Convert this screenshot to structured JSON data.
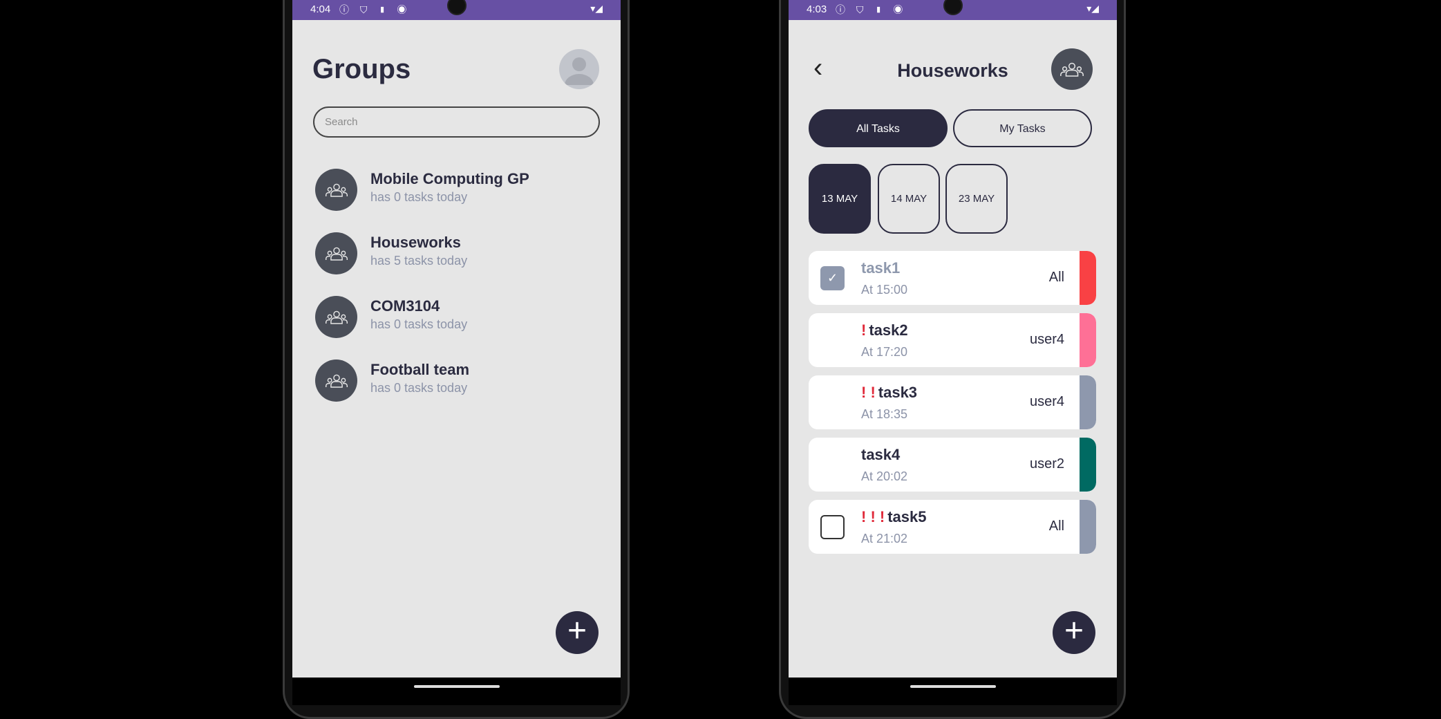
{
  "left_screen": {
    "status": {
      "time": "4:04",
      "icons": "ⓘ ⛉ ▮ ◉",
      "right": "▾◢"
    },
    "title": "Groups",
    "search": {
      "placeholder": "Search"
    },
    "groups": [
      {
        "name": "Mobile Computing GP",
        "subtitle": "has 0 tasks today"
      },
      {
        "name": "Houseworks",
        "subtitle": "has 5 tasks today"
      },
      {
        "name": "COM3104",
        "subtitle": "has 0 tasks today"
      },
      {
        "name": "Football team",
        "subtitle": "has 0 tasks today"
      }
    ],
    "fab": "+"
  },
  "right_screen": {
    "status": {
      "time": "4:03",
      "icons": "ⓘ ⛉ ▮ ◉",
      "right": "▾◢"
    },
    "back": "‹",
    "title": "Houseworks",
    "tabs": [
      {
        "label": "All Tasks",
        "active": true
      },
      {
        "label": "My Tasks",
        "active": false
      }
    ],
    "dates": [
      {
        "label": "13 MAY",
        "active": true
      },
      {
        "label": "14 MAY"
      },
      {
        "label": "23 MAY"
      }
    ],
    "tasks": [
      {
        "priority": "",
        "name": "task1",
        "time": "At 15:00",
        "assignee": "All",
        "color": "#f94144",
        "checkbox": "checked"
      },
      {
        "priority": "!",
        "name": "task2",
        "time": "At 17:20",
        "assignee": "user4",
        "color": "#fe7096",
        "checkbox": "none"
      },
      {
        "priority": "! !",
        "name": "task3",
        "time": "At 18:35",
        "assignee": "user4",
        "color": "#8e98ad",
        "checkbox": "none"
      },
      {
        "priority": "",
        "name": "task4",
        "time": "At 20:02",
        "assignee": "user2",
        "color": "#006a62",
        "checkbox": "none"
      },
      {
        "priority": "! ! !",
        "name": "task5",
        "time": "At 21:02",
        "assignee": "All",
        "color": "#8e98ad",
        "checkbox": "unchecked"
      }
    ],
    "fab": "+"
  }
}
